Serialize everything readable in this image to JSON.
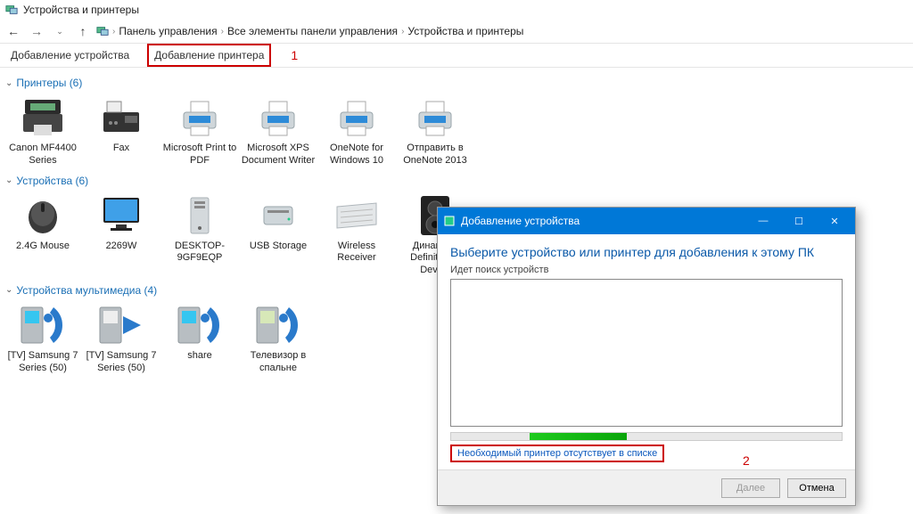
{
  "window_title": "Устройства и принтеры",
  "breadcrumb": {
    "item0": "Панель управления",
    "item1": "Все элементы панели управления",
    "item2": "Устройства и принтеры"
  },
  "toolbar": {
    "add_device": "Добавление устройства",
    "add_printer": "Добавление принтера",
    "annotation_1": "1"
  },
  "sections": {
    "printers": {
      "title": "Принтеры (6)"
    },
    "devices": {
      "title": "Устройства (6)"
    },
    "multimedia": {
      "title": "Устройства мультимедиа (4)"
    }
  },
  "printers": {
    "p0": "Canon MF4400 Series",
    "p1": "Fax",
    "p2": "Microsoft Print to PDF",
    "p3": "Microsoft XPS Document Writer",
    "p4": "OneNote for Windows 10",
    "p5": "Отправить в OneNote 2013"
  },
  "devices": {
    "d0": "2.4G Mouse",
    "d1": "2269W",
    "d2": "DESKTOP-9GF9EQP",
    "d3": "USB Storage",
    "d4": "Wireless Receiver",
    "d5": "Динамики Definition A Device"
  },
  "multimedia": {
    "m0": "[TV] Samsung 7 Series (50)",
    "m1": "[TV] Samsung 7 Series (50)",
    "m2": "share",
    "m3": "Телевизор в спальне"
  },
  "dialog": {
    "title": "Добавление устройства",
    "heading": "Выберите устройство или принтер для добавления к этому ПК",
    "subtext": "Идет поиск устройств",
    "missing_link": "Необходимый принтер отсутствует в списке",
    "annotation_2": "2",
    "btn_next": "Далее",
    "btn_cancel": "Отмена"
  }
}
